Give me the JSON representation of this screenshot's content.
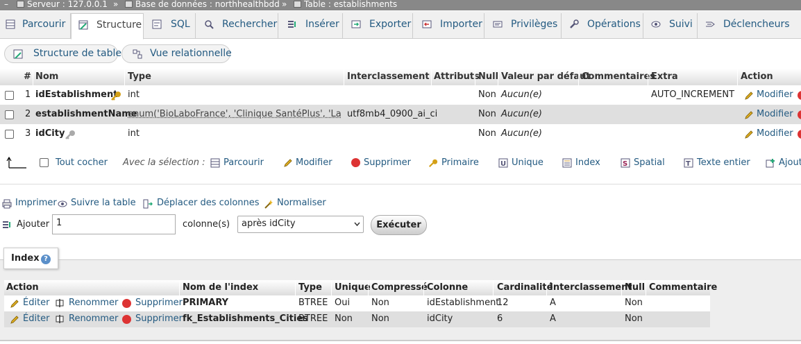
{
  "breadcrumb": {
    "server": "Serveur : 127.0.0.1",
    "database": "Base de données : northhealthbdd",
    "table": "Table : establishments",
    "sep": "»"
  },
  "tabs": [
    {
      "label": "Parcourir",
      "icon": "browse-icon"
    },
    {
      "label": "Structure",
      "icon": "structure-icon"
    },
    {
      "label": "SQL",
      "icon": "sql-icon"
    },
    {
      "label": "Rechercher",
      "icon": "search-icon"
    },
    {
      "label": "Insérer",
      "icon": "insert-icon"
    },
    {
      "label": "Exporter",
      "icon": "export-icon"
    },
    {
      "label": "Importer",
      "icon": "import-icon"
    },
    {
      "label": "Privilèges",
      "icon": "privileges-icon"
    },
    {
      "label": "Opérations",
      "icon": "operations-icon"
    },
    {
      "label": "Suivi",
      "icon": "tracking-icon"
    },
    {
      "label": "Déclencheurs",
      "icon": "triggers-icon"
    }
  ],
  "subnav": {
    "table_structure": "Structure de table",
    "relation_view": "Vue relationnelle"
  },
  "columns_table": {
    "headers": [
      "#",
      "Nom",
      "Type",
      "Interclassement",
      "Attributs",
      "Null",
      "Valeur par défaut",
      "Commentaires",
      "Extra",
      "Action"
    ],
    "rows": [
      {
        "num": "1",
        "name": "idEstablishment",
        "type": "int",
        "collation": "",
        "attributes": "",
        "null": "Non",
        "default": "Aucun(e)",
        "comments": "",
        "extra": "AUTO_INCREMENT",
        "action": "Modifier"
      },
      {
        "num": "2",
        "name": "establishmentName",
        "type": "enum('BioLaboFrance', 'Clinique SantéPlus', 'Labor...",
        "collation": "utf8mb4_0900_ai_ci",
        "attributes": "",
        "null": "Non",
        "default": "Aucun(e)",
        "comments": "",
        "extra": "",
        "action": "Modifier"
      },
      {
        "num": "3",
        "name": "idCity",
        "type": "int",
        "collation": "",
        "attributes": "",
        "null": "Non",
        "default": "Aucun(e)",
        "comments": "",
        "extra": "",
        "action": "Modifier"
      }
    ]
  },
  "selection_bar": {
    "check_all": "Tout cocher",
    "with_selection": "Avec la sélection :",
    "browse": "Parcourir",
    "modify": "Modifier",
    "delete": "Supprimer",
    "primary": "Primaire",
    "unique": "Unique",
    "index": "Index",
    "spatial": "Spatial",
    "fulltext": "Texte entier",
    "add": "Ajoute"
  },
  "table_actions": {
    "print": "Imprimer",
    "track": "Suivre la table",
    "move_columns": "Déplacer des colonnes",
    "normalize": "Normaliser"
  },
  "add_columns": {
    "label": "Ajouter",
    "count_value": "1",
    "columns_label": "colonne(s)",
    "position_selected": "après idCity",
    "execute": "Exécuter"
  },
  "indexes": {
    "legend": "Index",
    "headers": [
      "Action",
      "Nom de l'index",
      "Type",
      "Unique",
      "Compressé",
      "Colonne",
      "Cardinalité",
      "Interclassement",
      "Null",
      "Commentaire"
    ],
    "edit_label": "Éditer",
    "rename_label": "Renommer",
    "delete_label": "Supprimer",
    "rows": [
      {
        "name": "PRIMARY",
        "type": "BTREE",
        "unique": "Oui",
        "compressed": "Non",
        "column": "idEstablishment",
        "cardinality": "12",
        "collation": "A",
        "null": "Non",
        "comment": ""
      },
      {
        "name": "fk_Establishments_Cities",
        "type": "BTREE",
        "unique": "Non",
        "compressed": "Non",
        "column": "idCity",
        "cardinality": "6",
        "collation": "A",
        "null": "Non",
        "comment": ""
      }
    ]
  },
  "colors": {
    "link": "#235a81",
    "breadcrumb_bg": "#888888",
    "tab_bg": "#f0f0f0",
    "alt_row": "#dfdfdf",
    "key_gold": "#d4a017",
    "delete_red": "#dd3333"
  }
}
